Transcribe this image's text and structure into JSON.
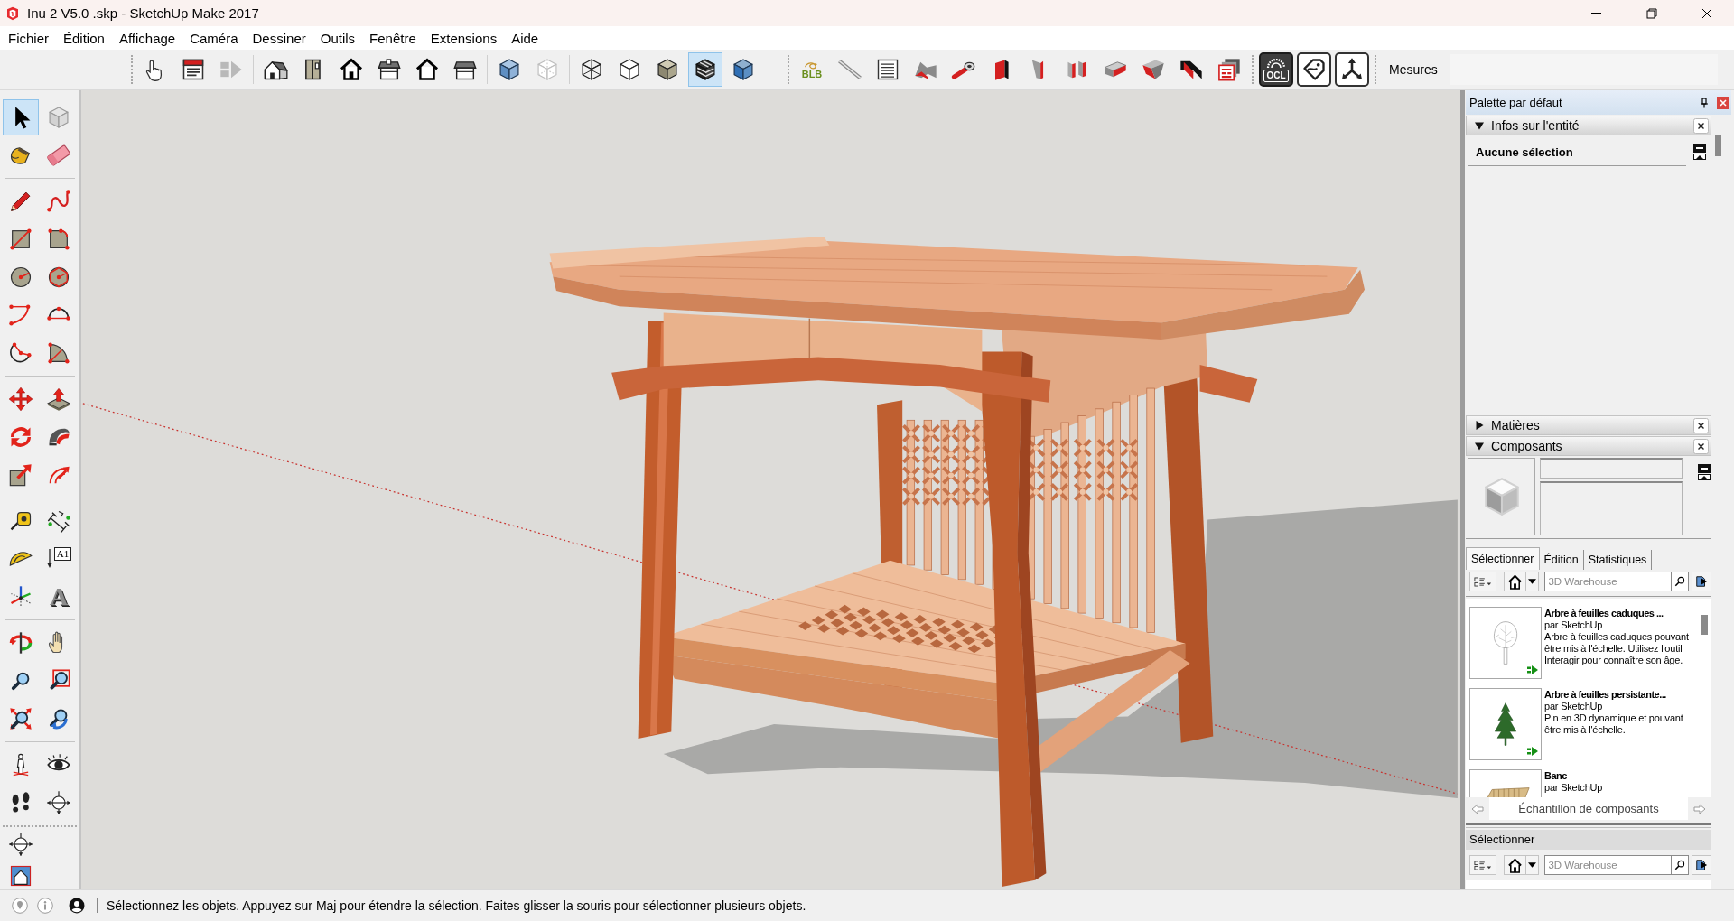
{
  "window": {
    "title": "Inu 2 V5.0 .skp - SketchUp Make 2017"
  },
  "menu": [
    {
      "label": "Fichier"
    },
    {
      "label": "Édition"
    },
    {
      "label": "Affichage"
    },
    {
      "label": "Caméra"
    },
    {
      "label": "Dessiner"
    },
    {
      "label": "Outils"
    },
    {
      "label": "Fenêtre"
    },
    {
      "label": "Extensions"
    },
    {
      "label": "Aide"
    }
  ],
  "toolbar": {
    "toolbars": [
      {
        "groups": [
          [
            {
              "kind": "tutorial",
              "selected": false,
              "disabled": false
            },
            {
              "kind": "instructor",
              "selected": false,
              "disabled": false
            },
            {
              "kind": "forward",
              "selected": false,
              "disabled": true
            }
          ],
          [
            {
              "kind": "iso",
              "selected": false,
              "disabled": false
            },
            {
              "kind": "top",
              "selected": false,
              "disabled": false
            },
            {
              "kind": "front",
              "selected": false,
              "disabled": false
            },
            {
              "kind": "right",
              "selected": false,
              "disabled": false
            },
            {
              "kind": "back",
              "selected": false,
              "disabled": false
            },
            {
              "kind": "left",
              "selected": false,
              "disabled": false
            }
          ],
          [
            {
              "kind": "xray",
              "selected": false,
              "disabled": false
            },
            {
              "kind": "backedges",
              "selected": false,
              "disabled": false
            }
          ],
          [
            {
              "kind": "wireframe",
              "selected": false,
              "disabled": false
            },
            {
              "kind": "hiddenline",
              "selected": false,
              "disabled": false
            },
            {
              "kind": "shaded",
              "selected": false,
              "disabled": false
            },
            {
              "kind": "textured",
              "selected": true,
              "disabled": false
            },
            {
              "kind": "monochrome",
              "selected": false,
              "disabled": false
            }
          ]
        ]
      },
      {
        "groups": [
          [
            {
              "kind": "blb",
              "label": "BLB",
              "selected": false,
              "disabled": false
            },
            {
              "kind": "stroke",
              "selected": false,
              "disabled": false
            },
            {
              "kind": "lines",
              "selected": false,
              "disabled": false
            },
            {
              "kind": "fold",
              "selected": false,
              "disabled": false
            },
            {
              "kind": "pipe",
              "selected": false,
              "disabled": false
            },
            {
              "kind": "panel",
              "selected": false,
              "disabled": false
            },
            {
              "kind": "post",
              "selected": false,
              "disabled": false
            },
            {
              "kind": "posts",
              "selected": false,
              "disabled": false
            },
            {
              "kind": "slab",
              "selected": false,
              "disabled": false
            },
            {
              "kind": "ramp",
              "selected": false,
              "disabled": false
            },
            {
              "kind": "corner",
              "selected": false,
              "disabled": false
            },
            {
              "kind": "layers",
              "selected": false,
              "disabled": false
            }
          ]
        ]
      },
      {
        "groups": [
          [
            {
              "kind": "ocl",
              "label": "OCL",
              "selected": false,
              "disabled": false
            },
            {
              "kind": "tag",
              "selected": false,
              "disabled": false
            },
            {
              "kind": "triad",
              "selected": false,
              "disabled": false
            }
          ]
        ]
      }
    ],
    "measurements": {
      "label": "Mesures"
    }
  },
  "tool_palette": {
    "toolbars": [
      {
        "groups": [
          [
            {
              "kind": "select",
              "selected": true
            },
            {
              "kind": "component",
              "selected": false
            },
            {
              "kind": "paint",
              "selected": false
            },
            {
              "kind": "eraser",
              "selected": false
            }
          ],
          [
            {
              "kind": "pencil",
              "selected": false
            },
            {
              "kind": "freehand",
              "selected": false
            },
            {
              "kind": "rectangle",
              "selected": false
            },
            {
              "kind": "rotrect",
              "selected": false
            },
            {
              "kind": "circle",
              "selected": false
            },
            {
              "kind": "polygon",
              "selected": false
            },
            {
              "kind": "arc",
              "selected": false
            },
            {
              "kind": "arc2",
              "selected": false
            },
            {
              "kind": "arc3",
              "selected": false
            },
            {
              "kind": "pie",
              "selected": false
            }
          ],
          [
            {
              "kind": "move",
              "selected": false
            },
            {
              "kind": "pushpull",
              "selected": false
            },
            {
              "kind": "rotate",
              "selected": false
            },
            {
              "kind": "followme",
              "selected": false
            },
            {
              "kind": "scale",
              "selected": false
            },
            {
              "kind": "offset",
              "selected": false
            }
          ],
          [
            {
              "kind": "tape",
              "selected": false
            },
            {
              "kind": "dimension",
              "selected": false
            },
            {
              "kind": "protractor",
              "selected": false
            },
            {
              "kind": "text",
              "label": "A1",
              "selected": false
            },
            {
              "kind": "axes",
              "selected": false
            },
            {
              "kind": "text3d",
              "label": "A",
              "selected": false
            }
          ],
          [
            {
              "kind": "orbit",
              "selected": false
            },
            {
              "kind": "pan",
              "selected": false
            },
            {
              "kind": "zoom",
              "selected": false
            },
            {
              "kind": "zoomwindow",
              "selected": false
            },
            {
              "kind": "extents",
              "selected": false
            },
            {
              "kind": "previous",
              "selected": false
            }
          ],
          [
            {
              "kind": "position",
              "selected": false
            },
            {
              "kind": "lookaround",
              "selected": false
            },
            {
              "kind": "walk",
              "selected": false
            },
            {
              "kind": "section",
              "selected": false
            }
          ]
        ]
      },
      {
        "groups": [
          [
            {
              "kind": "section",
              "selected": false
            },
            {
              "kind": "sectionfill",
              "selected": false
            }
          ]
        ]
      }
    ]
  },
  "tray": {
    "title": "Palette par défaut",
    "panels": [
      {
        "kind": "entity",
        "title": "Infos sur l'entité",
        "expanded": true,
        "status": "Aucune sélection"
      },
      {
        "kind": "materials",
        "title": "Matières",
        "expanded": false
      },
      {
        "kind": "components",
        "title": "Composants",
        "expanded": true,
        "tabs": [
          {
            "label": "Sélectionner",
            "selected": true
          },
          {
            "label": "Édition",
            "selected": false
          },
          {
            "label": "Statistiques",
            "selected": false
          }
        ],
        "search": {
          "placeholder": "3D Warehouse"
        },
        "items": [
          {
            "kind": "deciduous",
            "title": "Arbre à feuilles caduques ...",
            "author": "par SketchUp",
            "description": "Arbre à feuilles caduques pouvant être mis à l'échelle. Utilisez l'outil Interagir pour connaître son âge.",
            "dynamic": true
          },
          {
            "kind": "conifer",
            "title": "Arbre à feuilles persistante...",
            "author": "par SketchUp",
            "description": "Pin en 3D dynamique et pouvant être mis à l'échelle.",
            "dynamic": true
          },
          {
            "kind": "bench",
            "title": "Banc",
            "author": "par SketchUp"
          }
        ],
        "collection": "Échantillon de composants",
        "secondary": {
          "title": "Sélectionner",
          "search": {
            "placeholder": "3D Warehouse"
          }
        }
      }
    ]
  },
  "status_bar": {
    "text": "Sélectionnez les objets. Appuyez sur Maj pour étendre la sélection. Faites glisser la souris pour sélectionner plusieurs objets."
  }
}
